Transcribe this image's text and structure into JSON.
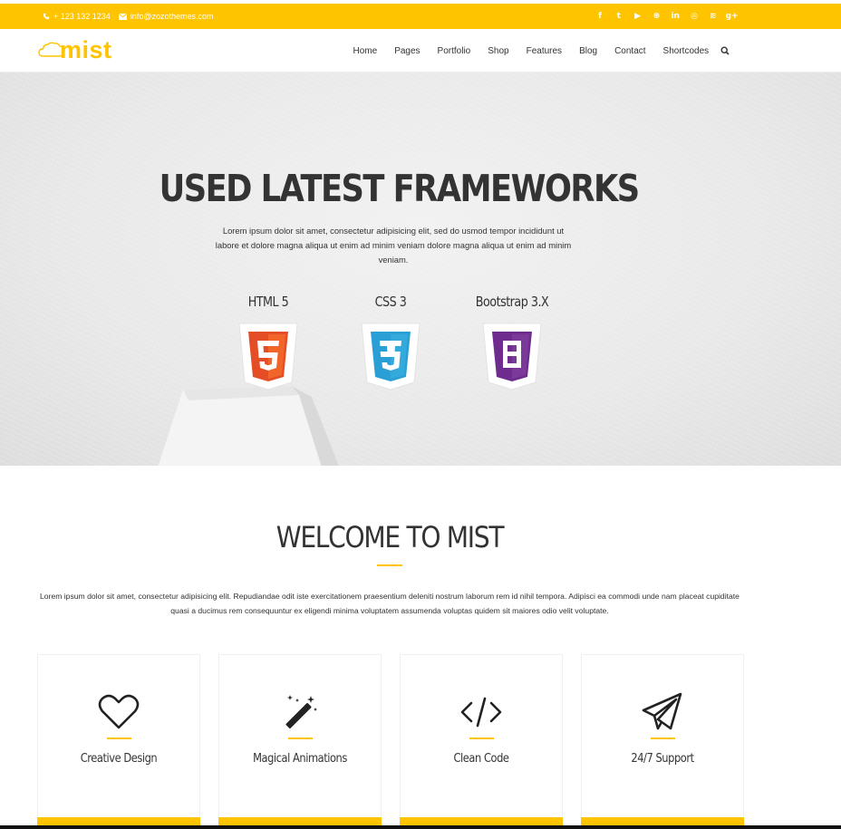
{
  "topbar": {
    "phone": "+ 123 132 1234",
    "email": "info@zozothemes.com",
    "social_icons": [
      "facebook-icon",
      "twitter-icon",
      "youtube-icon",
      "dribbble-icon",
      "linkedin-icon",
      "github-icon",
      "rss-icon",
      "google-plus-icon"
    ],
    "social_glyphs": [
      "f",
      "t",
      "▶",
      "⊛",
      "in",
      "◎",
      "≋",
      "g+"
    ]
  },
  "brand": {
    "logo_text": "mist",
    "accent": "#fec400"
  },
  "nav": {
    "items": [
      "Home",
      "Pages",
      "Portfolio",
      "Shop",
      "Features",
      "Blog",
      "Contact",
      "Shortcodes"
    ]
  },
  "hero": {
    "title": "USED LATEST FRAMEWORKS",
    "text": "Lorem ipsum dolor sit amet, consectetur adipisicing elit, sed do usmod tempor incididunt ut labore et dolore magna aliqua ut enim ad minim veniam dolore magna aliqua ut enim ad minim veniam.",
    "frameworks": [
      {
        "label": "HTML 5",
        "icon": "html5-icon",
        "color": "#e44d26",
        "glyph": "5"
      },
      {
        "label": "CSS 3",
        "icon": "css3-icon",
        "color": "#2a9fd6",
        "glyph": "3"
      },
      {
        "label": "Bootstrap 3.X",
        "icon": "bootstrap-icon",
        "color": "#6f2c8f",
        "glyph": "B"
      }
    ]
  },
  "welcome": {
    "title": "WELCOME TO MIST",
    "text": "Lorem ipsum dolor sit amet, consectetur adipisicing elit. Repudiandae odit iste exercitationem praesentium deleniti nostrum laborum rem id nihil tempora. Adipisci ea commodi unde nam placeat cupiditate quasi a ducimus rem consequuntur ex eligendi minima voluptatem assumenda voluptas quidem sit maiores odio velit voluptate."
  },
  "features": [
    {
      "title": "Creative Design",
      "icon": "heart-icon"
    },
    {
      "title": "Magical Animations",
      "icon": "magic-wand-icon"
    },
    {
      "title": "Clean Code",
      "icon": "code-icon"
    },
    {
      "title": "24/7 Support",
      "icon": "paper-plane-icon"
    }
  ]
}
